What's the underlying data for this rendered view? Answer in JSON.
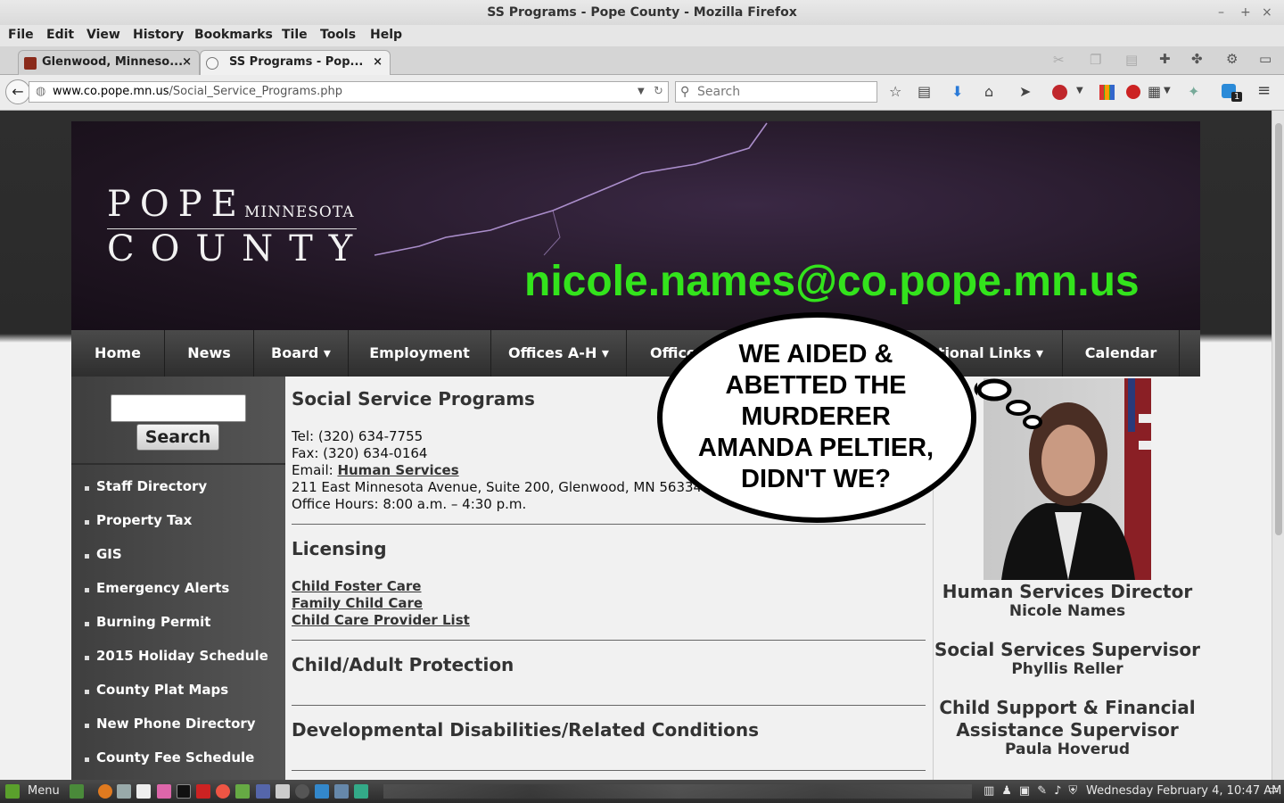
{
  "window": {
    "title": "SS Programs - Pope County - Mozilla Firefox",
    "minimize_glyph": "–",
    "maximize_glyph": "+",
    "close_glyph": "×"
  },
  "menu": [
    "File",
    "Edit",
    "View",
    "History",
    "Bookmarks",
    "Tile",
    "Tools",
    "Help"
  ],
  "tabs": [
    {
      "label": "Glenwood, Minneso...",
      "close": "×"
    },
    {
      "label": "SS Programs - Pop...",
      "close": "×"
    }
  ],
  "navbar": {
    "url_domain": "www.co.pope.mn.us",
    "url_path": "/Social_Service_Programs.php",
    "search_placeholder": "Search",
    "notification_count": "1"
  },
  "site": {
    "logo_pope": "POPE",
    "logo_minnesota": "MINNESOTA",
    "logo_county": "COUNTY",
    "email_overlay": "nicole.names@co.pope.mn.us",
    "nav": [
      {
        "label": "Home"
      },
      {
        "label": "News"
      },
      {
        "label": "Board ▾"
      },
      {
        "label": "Employment"
      },
      {
        "label": "Offices A-H ▾"
      },
      {
        "label": "Office"
      },
      {
        "label": "ational Links ▾"
      },
      {
        "label": "Calendar"
      }
    ],
    "sidebar": {
      "search_button": "Search",
      "links": [
        "Staff Directory",
        "Property Tax",
        "GIS",
        "Emergency Alerts",
        "Burning Permit",
        "2015 Holiday Schedule",
        "County Plat Maps",
        "New Phone Directory",
        "County Fee Schedule"
      ]
    },
    "content": {
      "heading": "Social Service Programs",
      "tel": "Tel: (320) 634-7755",
      "fax": "Fax: (320) 634-0164",
      "email_label": "Email: ",
      "email_link": "Human Services",
      "address": "211 East Minnesota Avenue, Suite 200, Glenwood, MN 56334",
      "hours": "Office Hours: 8:00 a.m. – 4:30 p.m.",
      "licensing_heading": "Licensing",
      "licensing_links": [
        "Child Foster Care",
        "Family Child Care",
        "Child Care Provider List"
      ],
      "protection_heading": "Child/Adult Protection",
      "disabilities_heading": "Developmental Disabilities/Related Conditions"
    },
    "right": {
      "director_title": "Human Services Director",
      "director_name": "Nicole Names",
      "supervisor_title": "Social Services Supervisor",
      "supervisor_name": "Phyllis Reller",
      "cs_title_1": "Child Support & Financial",
      "cs_title_2": "Assistance Supervisor",
      "cs_name": "Paula Hoverud"
    },
    "bubble_lines": [
      "WE AIDED &",
      "ABETTED THE",
      "MURDERER",
      "AMANDA PELTIER,",
      "DIDN'T WE?"
    ]
  },
  "taskbar": {
    "menu_label": "Menu",
    "clock": "Wednesday February  4, 10:47 AM"
  },
  "colors": {
    "email_overlay": "#33e31c",
    "nav_bg": "#3a3a3a",
    "banner_bg": "#241828"
  }
}
